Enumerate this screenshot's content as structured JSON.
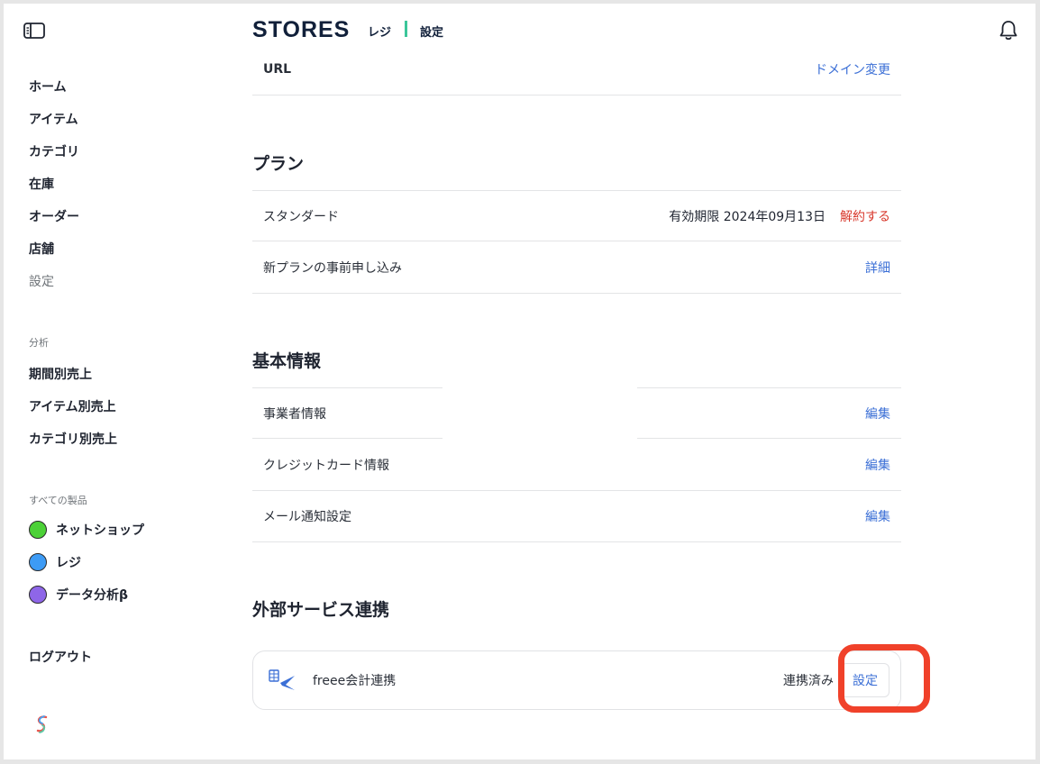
{
  "header": {
    "brand": "STORES",
    "product": "レジ",
    "page": "設定"
  },
  "sidebar": {
    "nav": [
      "ホーム",
      "アイテム",
      "カテゴリ",
      "在庫",
      "オーダー",
      "店舗",
      "設定"
    ],
    "analysis_section": "分析",
    "analysis_items": [
      "期間別売上",
      "アイテム別売上",
      "カテゴリ別売上"
    ],
    "products_section": "すべての製品",
    "products": [
      {
        "label": "ネットショップ",
        "color": "#4cd137"
      },
      {
        "label": "レジ",
        "color": "#3d9bf5"
      },
      {
        "label": "データ分析β",
        "color": "#8e66e8"
      }
    ],
    "logout": "ログアウト"
  },
  "url_row": {
    "label": "URL",
    "action": "ドメイン変更"
  },
  "plan": {
    "title": "プラン",
    "rows": [
      {
        "label": "スタンダード",
        "info": "有効期限 2024年09月13日",
        "action": "解約する"
      },
      {
        "label": "新プランの事前申し込み",
        "action": "詳細"
      }
    ]
  },
  "basic_info": {
    "title": "基本情報",
    "rows": [
      {
        "label": "事業者情報",
        "action": "編集"
      },
      {
        "label": "クレジットカード情報",
        "action": "編集"
      },
      {
        "label": "メール通知設定",
        "action": "編集"
      }
    ]
  },
  "integrations": {
    "title": "外部サービス連携",
    "service": {
      "name": "freee会計連携",
      "status": "連携済み",
      "action": "設定"
    }
  },
  "colors": {
    "accent_link": "#3b6fd6",
    "danger": "#d8382c",
    "highlight": "#f0412a",
    "brand_sep": "#3bc69a"
  }
}
